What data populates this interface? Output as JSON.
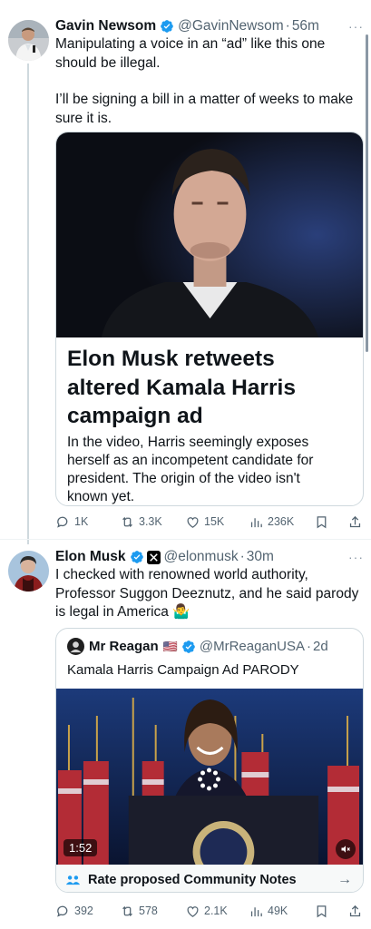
{
  "tweet1": {
    "name": "Gavin Newsom",
    "handle": "@GavinNewsom",
    "dot": "·",
    "time": "56m",
    "more": "···",
    "line1": "Manipulating a voice in an “ad” like this one",
    "line2": "should be illegal.",
    "line3": "I’ll be signing a bill in a matter of weeks to make",
    "line4": "sure it is.",
    "card": {
      "headline1": "Elon Musk retweets",
      "headline2": "altered Kamala Harris",
      "headline3": "campaign ad",
      "desc1": "In the video, Harris seemingly exposes",
      "desc2": "herself as an incompetent candidate for",
      "desc3": "president. The origin of the video isn't",
      "desc4": "known yet."
    },
    "stats": {
      "replies": "1K",
      "reposts": "3.3K",
      "likes": "15K",
      "views": "236K"
    }
  },
  "tweet2": {
    "name": "Elon Musk",
    "handle": "@elonmusk",
    "dot": "·",
    "time": "30m",
    "more": "···",
    "line1": "I checked with renowned world authority,",
    "line2": "Professor Suggon Deeznutz, and he said parody",
    "line3": "is legal in America",
    "emoji": "🤷‍♂️",
    "quote": {
      "name": "Mr Reagan",
      "flag": "🇺🇸",
      "handle": "@MrReaganUSA",
      "dot": "·",
      "time": "2d",
      "text": "Kamala Harris Campaign Ad PARODY",
      "duration": "1:52",
      "notes": "Rate proposed Community Notes",
      "notes_arrow": "→"
    },
    "stats": {
      "replies": "392",
      "reposts": "578",
      "likes": "2.1K",
      "views": "49K"
    }
  },
  "colors": {
    "verified": "#1d9bf0",
    "text": "#0f1419",
    "secondary": "#536471",
    "border": "#cfd9de"
  }
}
